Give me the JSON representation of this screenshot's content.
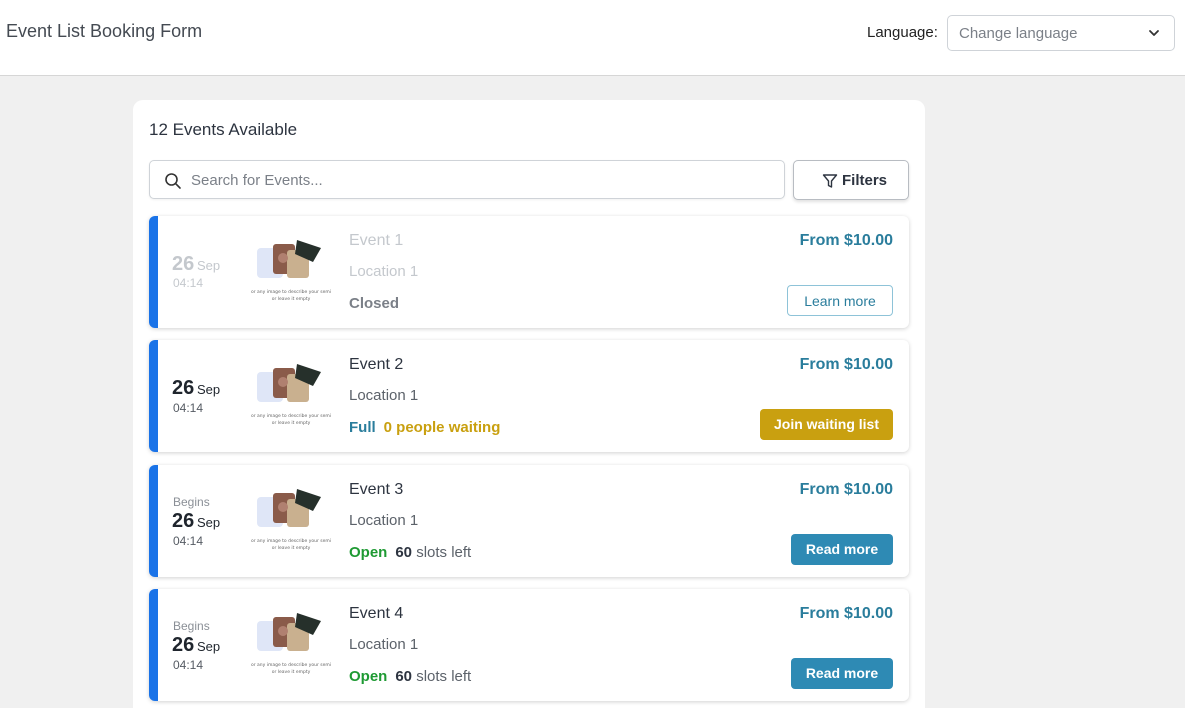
{
  "app": {
    "title": "Event List Booking Form"
  },
  "language": {
    "label": "Language:",
    "selected": "Change language"
  },
  "list": {
    "count_title": "12 Events Available",
    "search_placeholder": "Search for Events...",
    "filters_label": "Filters",
    "thumb_caption_1": "or any image to describe your semi",
    "thumb_caption_2": "or leave it empty"
  },
  "events": [
    {
      "begins": "",
      "day": "26",
      "month": "Sep",
      "time": "04:14",
      "title": "Event 1",
      "location": "Location 1",
      "status": "Closed",
      "status_extra": "",
      "status_extra2": "",
      "price": "From $10.00",
      "button": "Learn more"
    },
    {
      "begins": "",
      "day": "26",
      "month": "Sep",
      "time": "04:14",
      "title": "Event 2",
      "location": "Location 1",
      "status": "Full",
      "status_extra": "0 people waiting",
      "status_extra2": "",
      "price": "From $10.00",
      "button": "Join waiting list"
    },
    {
      "begins": "Begins",
      "day": "26",
      "month": "Sep",
      "time": "04:14",
      "title": "Event 3",
      "location": "Location 1",
      "status": "Open",
      "status_extra": "60",
      "status_extra2": " slots left",
      "price": "From $10.00",
      "button": "Read more"
    },
    {
      "begins": "Begins",
      "day": "26",
      "month": "Sep",
      "time": "04:14",
      "title": "Event 4",
      "location": "Location 1",
      "status": "Open",
      "status_extra": "60",
      "status_extra2": " slots left",
      "price": "From $10.00",
      "button": "Read more"
    }
  ],
  "colors": {
    "accent_bar": "#1a73e8",
    "price": "#2a7d9c",
    "waiting": "#c9a010",
    "open": "#1e9a33",
    "read_button": "#2e8ab4"
  }
}
